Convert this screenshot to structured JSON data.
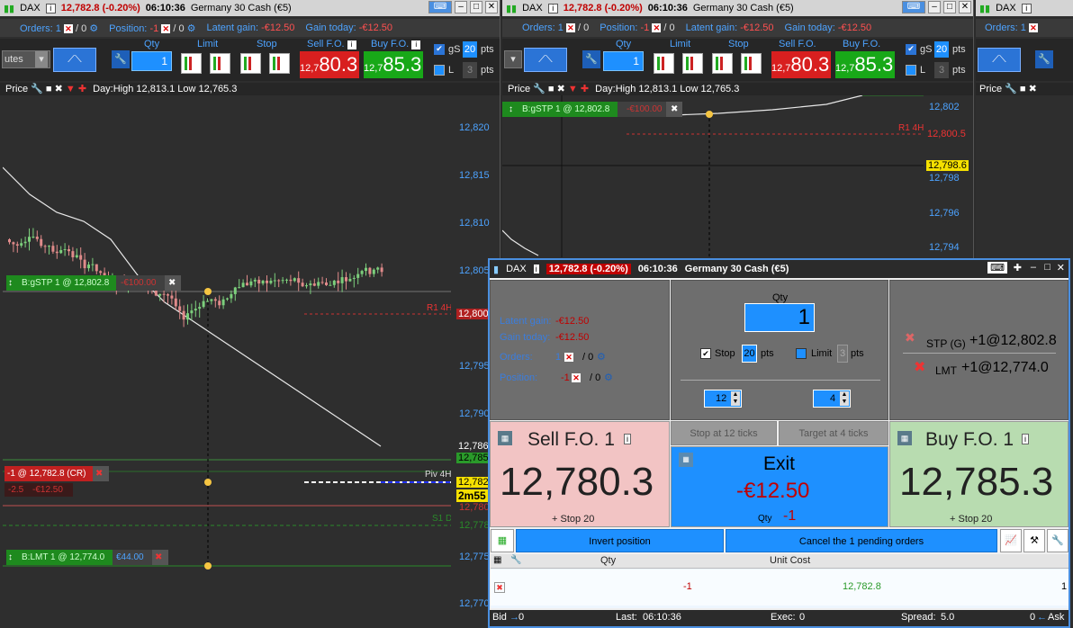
{
  "header": {
    "instrument": "DAX",
    "price_change": "12,782.8 (-0.20%)",
    "time": "06:10:36",
    "name": "Germany 30 Cash (€5)"
  },
  "status": {
    "orders_label": "Orders:",
    "orders_val": "1",
    "orders_zero": "/ 0",
    "position_label": "Position:",
    "position_val": "-1",
    "position_zero": "/ 0",
    "latent_label": "Latent gain:",
    "latent_val": "-€12.50",
    "today_label": "Gain today:",
    "today_val": "-€12.50"
  },
  "toolbar": {
    "timeframe": "utes",
    "qty_label": "Qty",
    "qty_value": "1",
    "limit_label": "Limit",
    "stop_label": "Stop",
    "sell_label": "Sell F.O.",
    "buy_label": "Buy F.O.",
    "sell_prefix": "12,7",
    "sell_big": "80.3",
    "buy_prefix": "12,7",
    "buy_big": "85.3",
    "gs": "gS",
    "gs_val": "20",
    "pts": "pts",
    "l": "L",
    "l_val": "3"
  },
  "pricebar": {
    "label": "Price",
    "dayinfo": "Day:High 12,813.1 Low 12,765.3"
  },
  "axis1": {
    "ticks": [
      "12,820",
      "12,815",
      "12,810",
      "12,805",
      "12,800",
      "12,795",
      "12,790",
      "12,786",
      "12,785",
      "12,782",
      "12,780",
      "12,778",
      "12,775",
      "12,770"
    ]
  },
  "axis2": {
    "ticks": [
      "12,802",
      "12,800.5",
      "12,798.6",
      "12,798",
      "12,796",
      "12,794"
    ]
  },
  "chart1": {
    "stp_label": "B:gSTP 1 @ 12,802.8",
    "stp_gain": "-€100.00",
    "lmt_label": "B:LMT 1 @ 12,774.0",
    "lmt_gain": "€44.00",
    "pos_label": "-1 @ 12,782.8 (CR)",
    "pos_pts": "-2.5",
    "pos_gain": "-€12.50",
    "r1": "R1 4H",
    "piv": "Piv 4H",
    "s1": "S1 D",
    "timer": "2m55"
  },
  "chart2": {
    "stp_label": "B:gSTP 1 @ 12,802.8",
    "stp_gain": "-€100.00",
    "r1": "R1 4H"
  },
  "panel": {
    "qty_label": "Qty",
    "qty": "1",
    "stop_label": "Stop",
    "stop_val": "20",
    "limit_label": "Limit",
    "limit_val": "3",
    "pts": "pts",
    "spin_stop": "12",
    "spin_target": "4",
    "latent_label": "Latent gain:",
    "latent_val": "-€12.50",
    "today_label": "Gain today:",
    "today_val": "-€12.50",
    "orders_label": "Orders:",
    "orders_val": "1",
    "orders_zero": "/ 0",
    "position_label": "Position:",
    "position_val": "-1",
    "position_zero": "/ 0",
    "stp_type": "STP (G)",
    "stp_order": "+1@12,802.8",
    "lmt_type": "LMT",
    "lmt_order": "+1@12,774.0",
    "sell_title": "Sell F.O. 1",
    "sell_price": "12,780.3",
    "sell_sub": "+ Stop 20",
    "buy_title": "Buy F.O. 1",
    "buy_price": "12,785.3",
    "buy_sub": "+ Stop 20",
    "stop_ticks": "Stop at 12 ticks",
    "target_ticks": "Target at 4 ticks",
    "exit": "Exit",
    "exit_val": "-€12.50",
    "exit_qty_label": "Qty",
    "exit_qty": "-1",
    "invert": "Invert position",
    "cancel": "Cancel the 1 pending orders",
    "col_qty": "Qty",
    "col_cost": "Unit Cost",
    "row_qty": "-1",
    "row_cost": "12,782.8",
    "row_last": "1",
    "bid_label": "Bid",
    "bid_val": "0",
    "last_label": "Last:",
    "last_val": "06:10:36",
    "exec_label": "Exec:",
    "exec_val": "0",
    "spread_label": "Spread:",
    "spread_val": "5.0",
    "ask_val": "0",
    "ask_label": "Ask"
  }
}
